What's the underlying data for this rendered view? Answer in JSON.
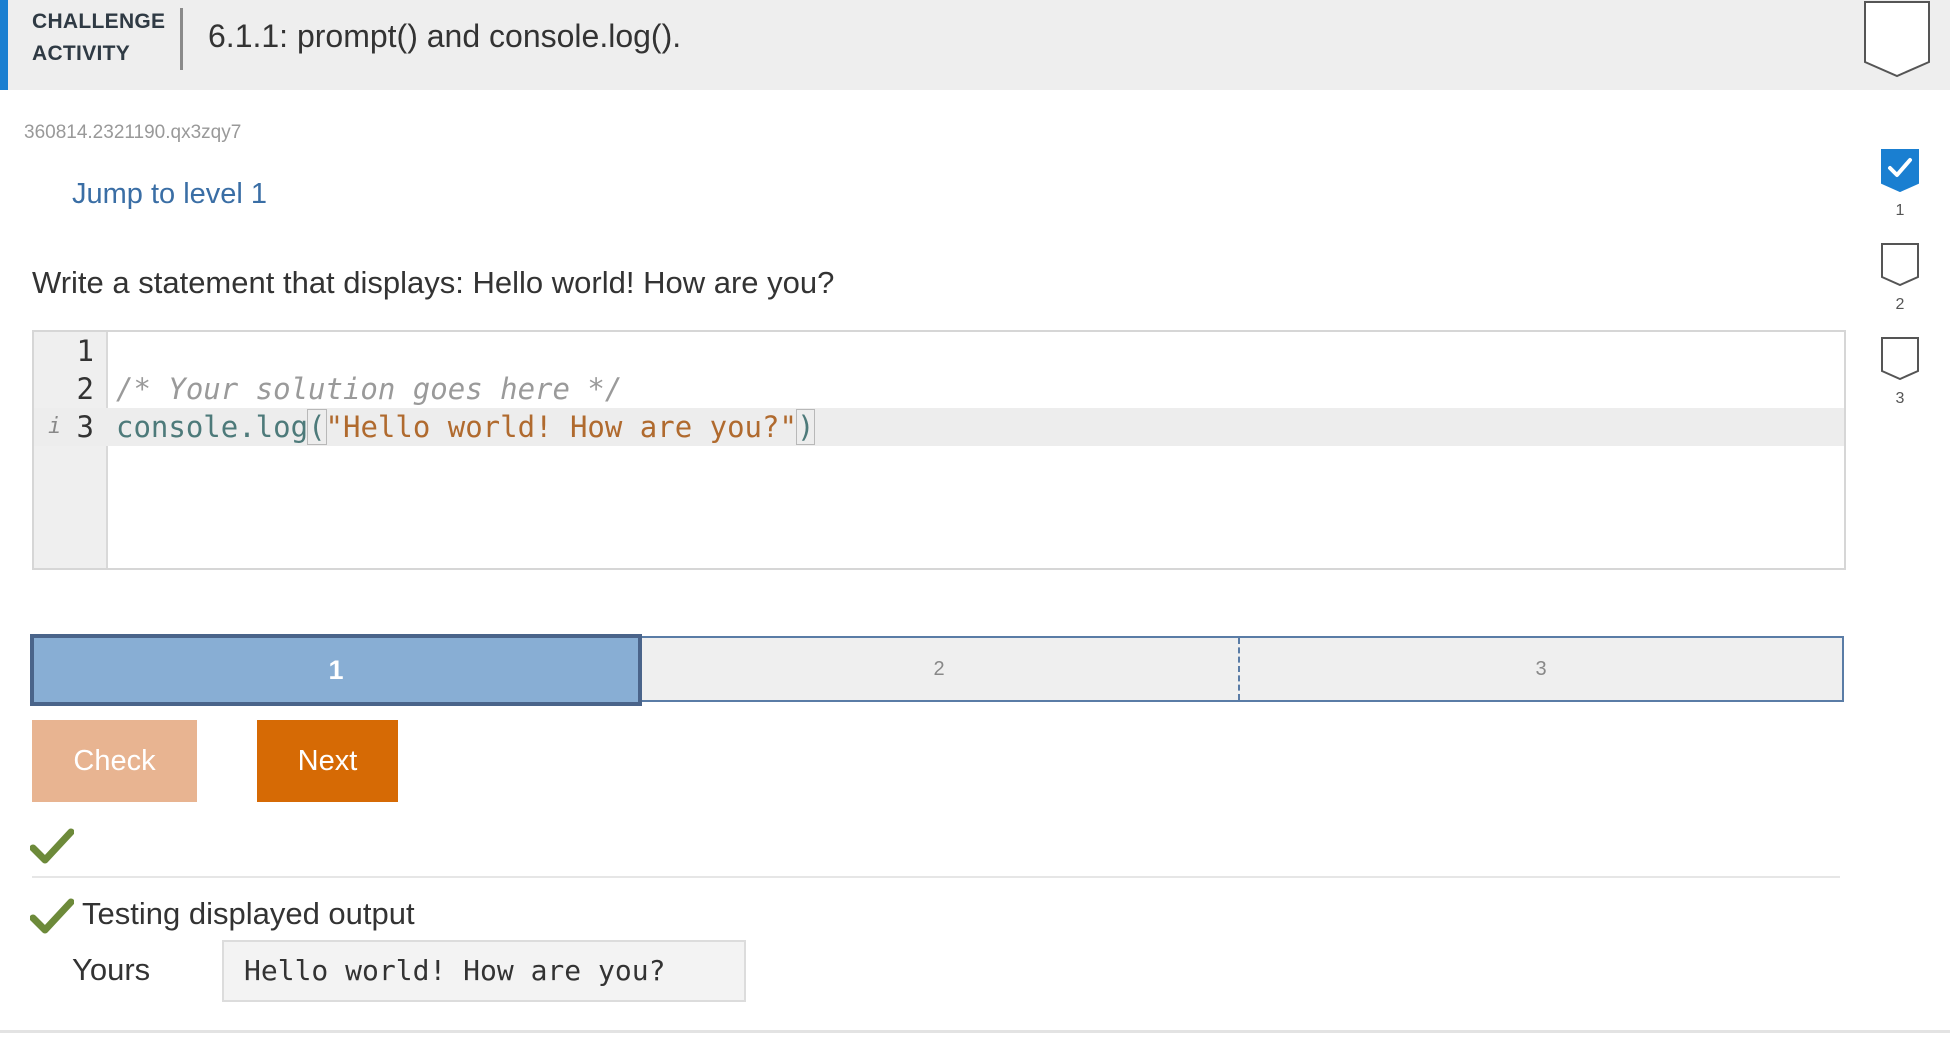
{
  "header": {
    "label_line1": "CHALLENGE",
    "label_line2": "ACTIVITY",
    "title": "6.1.1: prompt() and console.log()."
  },
  "activity_id": "360814.2321190.qx3zqy7",
  "jump_link": "Jump to level 1",
  "instructions": "Write a statement that displays: Hello world! How are you?",
  "editor": {
    "lines": [
      {
        "number": "1",
        "text": ""
      },
      {
        "number": "2",
        "text": "/* Your solution goes here */"
      },
      {
        "number": "3",
        "fn": "console.log",
        "open_paren": "(",
        "string": "\"Hello world! How are you?\"",
        "close_paren": ")",
        "marker": "i"
      }
    ]
  },
  "levels": [
    {
      "label": "1",
      "state": "current"
    },
    {
      "label": "2",
      "state": "locked"
    },
    {
      "label": "3",
      "state": "locked"
    }
  ],
  "buttons": {
    "check": "Check",
    "next": "Next"
  },
  "results": {
    "test_name": "Testing displayed output",
    "yours_label": "Yours",
    "output": "Hello world! How are you?"
  },
  "side_levels": [
    {
      "number": "1",
      "completed": true
    },
    {
      "number": "2",
      "completed": false
    },
    {
      "number": "3",
      "completed": false
    }
  ],
  "colors": {
    "accent": "#1a7fd1",
    "level_active": "#88aed4",
    "next_button": "#d66a05",
    "check_button_disabled": "#e8b491",
    "check_mark": "#6d8a3a"
  },
  "icons": {
    "header_badge": "shield-outline-icon",
    "completed_badge": "check-badge-icon",
    "pending_badge": "shield-outline-icon",
    "result_check": "checkmark-icon"
  }
}
